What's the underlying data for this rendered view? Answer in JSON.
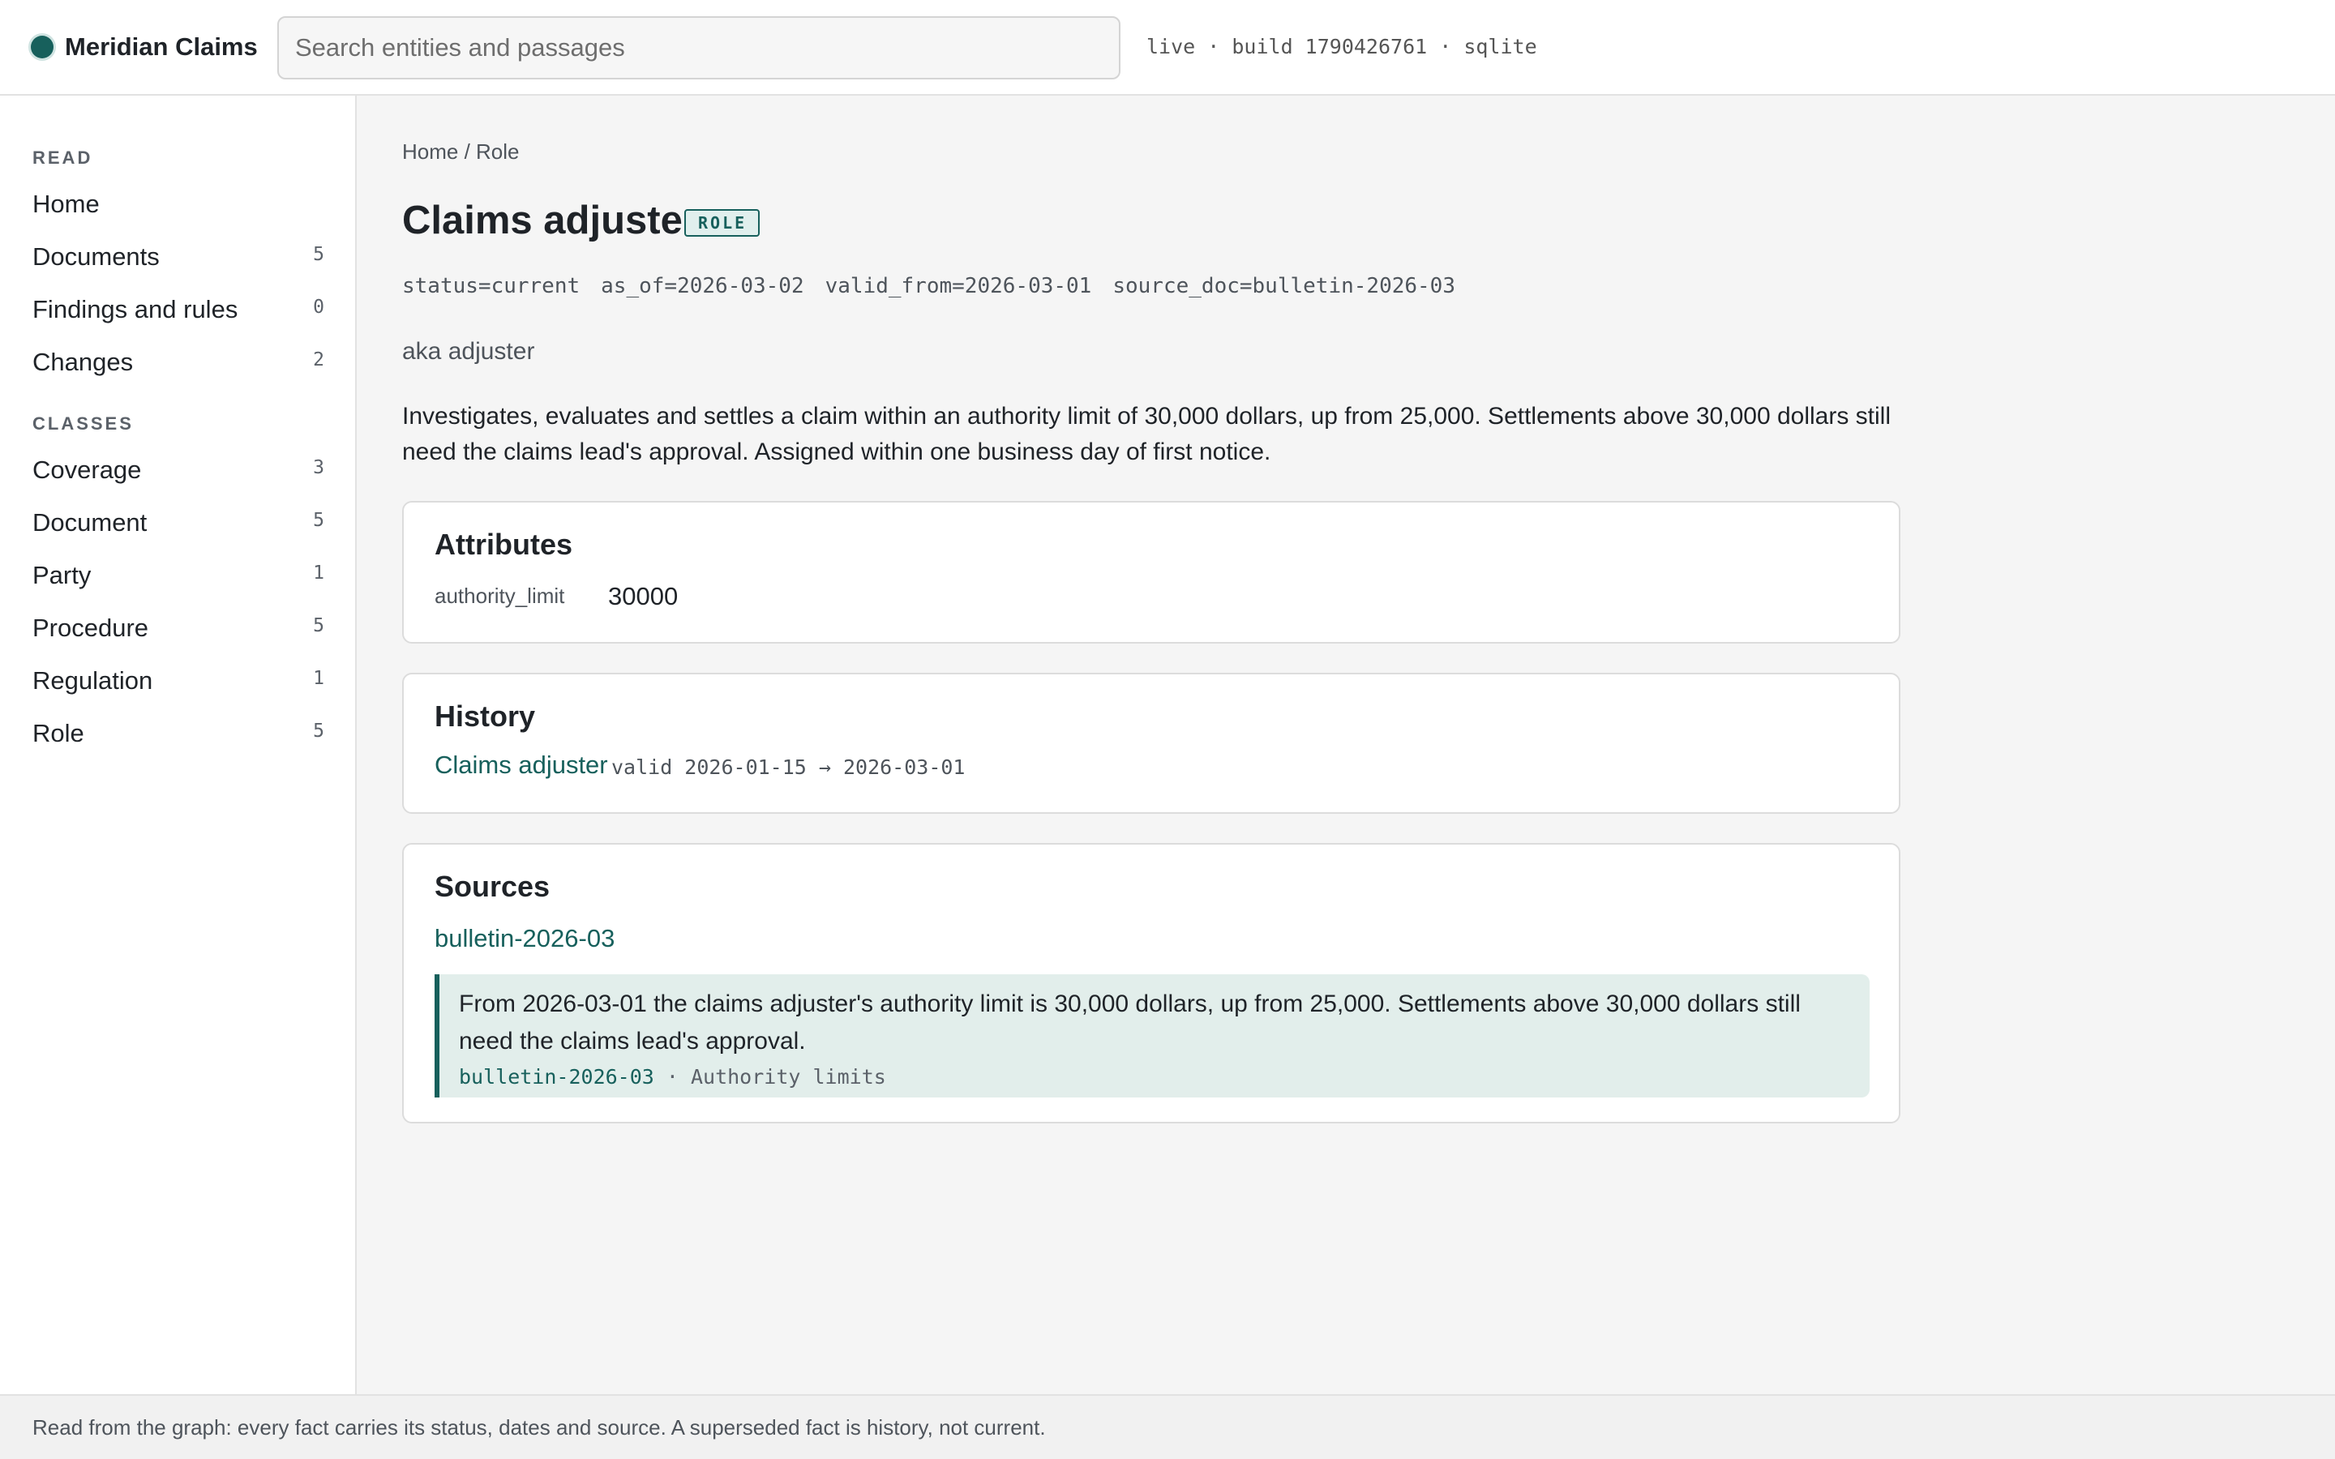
{
  "header": {
    "app_name": "Meridian Claims",
    "search_placeholder": "Search entities and passages",
    "build_info": "live · build 1790426761 · sqlite"
  },
  "sidebar": {
    "read_label": "READ",
    "read_items": [
      {
        "label": "Home",
        "count": ""
      },
      {
        "label": "Documents",
        "count": "5"
      },
      {
        "label": "Findings and rules",
        "count": "0"
      },
      {
        "label": "Changes",
        "count": "2"
      }
    ],
    "classes_label": "CLASSES",
    "class_items": [
      {
        "label": "Coverage",
        "count": "3"
      },
      {
        "label": "Document",
        "count": "5"
      },
      {
        "label": "Party",
        "count": "1"
      },
      {
        "label": "Procedure",
        "count": "5"
      },
      {
        "label": "Regulation",
        "count": "1"
      },
      {
        "label": "Role",
        "count": "5"
      }
    ]
  },
  "breadcrumb": {
    "home": "Home",
    "separator": " / ",
    "current": "Role"
  },
  "entity": {
    "title": "Claims adjuster",
    "badge": "ROLE",
    "meta": [
      "status=current",
      "as_of=2026-03-02",
      "valid_from=2026-03-01",
      "source_doc=bulletin-2026-03"
    ],
    "aka": "aka adjuster",
    "description": "Investigates, evaluates and settles a claim within an authority limit of 30,000 dollars, up from 25,000. Settlements above 30,000 dollars still need the claims lead's approval. Assigned within one business day of first notice."
  },
  "attributes": {
    "title": "Attributes",
    "rows": [
      {
        "key": "authority_limit",
        "value": "30000"
      }
    ]
  },
  "history": {
    "title": "History",
    "entries": [
      {
        "link": "Claims adjuster",
        "valid": "valid 2026-01-15 → 2026-03-01"
      }
    ]
  },
  "sources": {
    "title": "Sources",
    "link": "bulletin-2026-03",
    "quote": "From 2026-03-01 the claims adjuster's authority limit is 30,000 dollars, up from 25,000. Settlements above 30,000 dollars still need the claims lead's approval.",
    "cite_doc": "bulletin-2026-03",
    "cite_section": " · Authority limits"
  },
  "footer": {
    "text": "Read from the graph: every fact carries its status, dates and source. A superseded fact is history, not current."
  },
  "colors": {
    "accent": "#17605c",
    "accent_light": "#e2eeeb",
    "text": "#1f2328",
    "muted": "#4e545b"
  }
}
